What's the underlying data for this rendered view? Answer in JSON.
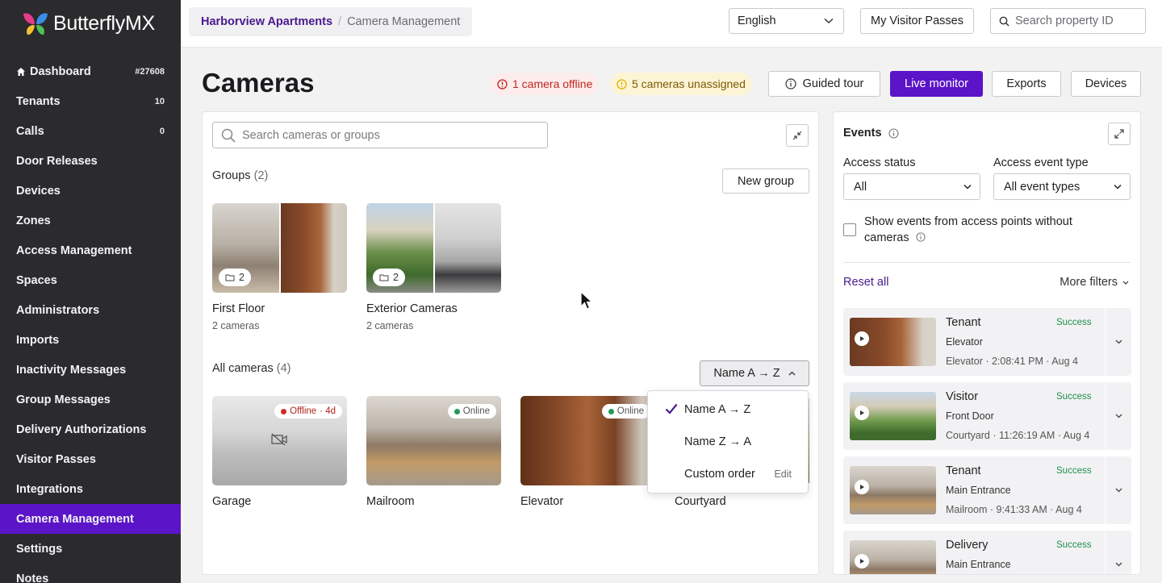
{
  "brand": {
    "name": "ButterflyMX"
  },
  "sidebar": {
    "items": [
      {
        "label": "Dashboard",
        "count": "#27608",
        "icon": "home-icon"
      },
      {
        "label": "Tenants",
        "count": "10"
      },
      {
        "label": "Calls",
        "count": "0"
      },
      {
        "label": "Door Releases"
      },
      {
        "label": "Devices"
      },
      {
        "label": "Zones"
      },
      {
        "label": "Access Management"
      },
      {
        "label": "Spaces"
      },
      {
        "label": "Administrators"
      },
      {
        "label": "Imports"
      },
      {
        "label": "Inactivity Messages"
      },
      {
        "label": "Group Messages"
      },
      {
        "label": "Delivery Authorizations"
      },
      {
        "label": "Visitor Passes"
      },
      {
        "label": "Integrations"
      },
      {
        "label": "Camera Management",
        "active": true
      },
      {
        "label": "Settings"
      },
      {
        "label": "Notes"
      }
    ]
  },
  "header": {
    "breadcrumb": {
      "property": "Harborview Apartments",
      "separator": "/",
      "current": "Camera Management"
    },
    "language": "English",
    "visitor_passes_label": "My Visitor Passes",
    "search_placeholder": "Search property ID"
  },
  "page": {
    "title": "Cameras",
    "alerts": {
      "offline": "1 camera offline",
      "unassigned": "5 cameras unassigned"
    },
    "buttons": {
      "guided_tour": "Guided tour",
      "live_monitor": "Live monitor",
      "exports": "Exports",
      "devices": "Devices"
    }
  },
  "cameras_panel": {
    "search_placeholder": "Search cameras or groups",
    "groups_label": "Groups",
    "groups_count": "(2)",
    "new_group_label": "New group",
    "groups": [
      {
        "name": "First Floor",
        "sub": "2 cameras",
        "badge": "2"
      },
      {
        "name": "Exterior Cameras",
        "sub": "2 cameras",
        "badge": "2"
      }
    ],
    "all_label": "All cameras",
    "all_count": "(4)",
    "sort_label": "Name A → Z",
    "cameras": [
      {
        "name": "Garage",
        "status": "Offline",
        "since": "· 4d"
      },
      {
        "name": "Mailroom",
        "status": "Online"
      },
      {
        "name": "Elevator",
        "status": "Online"
      },
      {
        "name": "Courtyard"
      }
    ],
    "sort_menu": {
      "options": [
        "Name A → Z",
        "Name Z → A",
        "Custom order"
      ],
      "selected": "Name A → Z",
      "edit_label": "Edit"
    }
  },
  "events_panel": {
    "title": "Events",
    "access_status_label": "Access status",
    "access_status_value": "All",
    "event_type_label": "Access event type",
    "event_type_value": "All event types",
    "checkbox_label": "Show events from access points without cameras",
    "checkbox_checked": false,
    "reset_label": "Reset all",
    "more_filters_label": "More filters",
    "events": [
      {
        "who": "Tenant",
        "status": "Success",
        "where": "Elevator",
        "meta": "Elevator · 2:08:41 PM · Aug 4"
      },
      {
        "who": "Visitor",
        "status": "Success",
        "where": "Front Door",
        "meta": "Courtyard · 11:26:19 AM · Aug 4"
      },
      {
        "who": "Tenant",
        "status": "Success",
        "where": "Main Entrance",
        "meta": "Mailroom · 9:41:33 AM · Aug 4"
      },
      {
        "who": "Delivery",
        "status": "Success",
        "where": "Main Entrance",
        "meta": ""
      }
    ]
  },
  "colors": {
    "accent": "#5b14c7",
    "sidebar_bg": "#2b2b2e",
    "offline": "#d32a22",
    "online": "#1f9a58",
    "success": "#1f8f4a",
    "warning": "#e0b400"
  }
}
